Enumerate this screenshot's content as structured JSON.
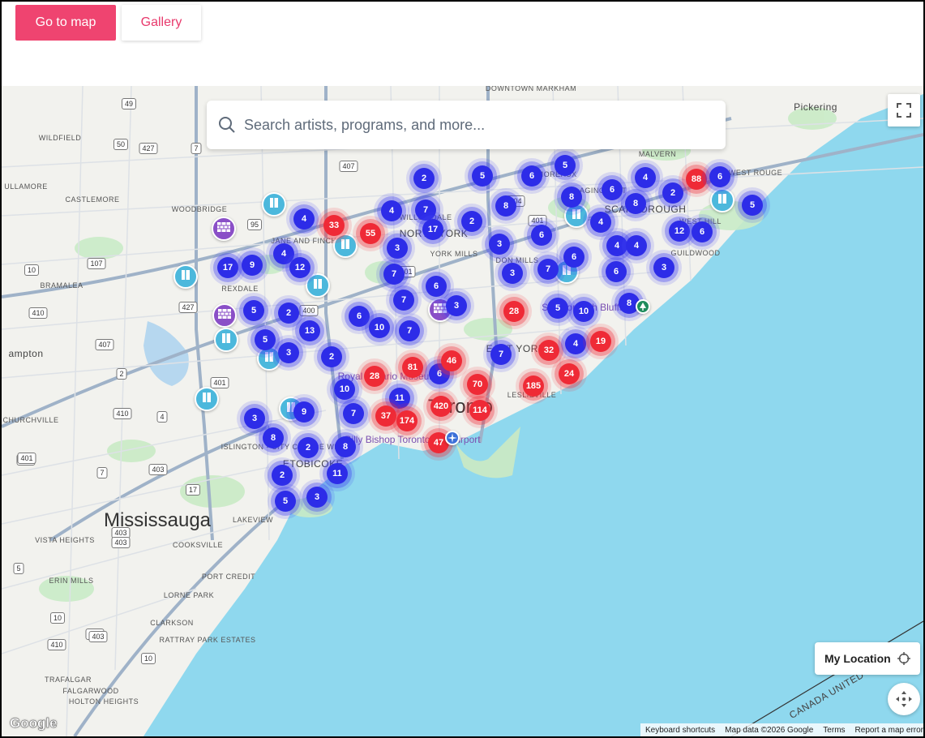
{
  "header": {
    "map_button": "Go to map",
    "gallery_button": "Gallery"
  },
  "search": {
    "placeholder": "Search artists, programs, and more..."
  },
  "controls": {
    "my_location": "My Location"
  },
  "attribution": {
    "keyboard": "Keyboard shortcuts",
    "mapdata": "Map data ©2026 Google",
    "terms": "Terms",
    "report": "Report a map error",
    "logo": "Google"
  },
  "colors": {
    "cluster_blue": "#2d2ce8",
    "cluster_red": "#ef2a36",
    "pin_cyan": "#4cb8dc",
    "pin_purple": "#8a4fc7",
    "water": "#8fd8ee",
    "accent": "#ef4470"
  },
  "labels": [
    {
      "text": "Mississauga",
      "cls": "big"
    },
    {
      "text": "Toronto",
      "cls": "big"
    },
    {
      "text": "Pickering",
      "cls": "mid"
    },
    {
      "text": "ampton",
      "cls": "mid"
    },
    {
      "text": "WILDFIELD",
      "cls": ""
    },
    {
      "text": "ULLAMORE",
      "cls": ""
    },
    {
      "text": "CASTLEMORE",
      "cls": ""
    },
    {
      "text": "WOODBRIDGE",
      "cls": ""
    },
    {
      "text": "BRAMALEA",
      "cls": ""
    },
    {
      "text": "REXDALE",
      "cls": ""
    },
    {
      "text": "JANE AND FINCH",
      "cls": ""
    },
    {
      "text": "NORTH YORK",
      "cls": "mid"
    },
    {
      "text": "YORK MILLS",
      "cls": ""
    },
    {
      "text": "DON MILLS",
      "cls": ""
    },
    {
      "text": "SCARBOROUGH",
      "cls": "mid"
    },
    {
      "text": "WEST HILL",
      "cls": ""
    },
    {
      "text": "GUILDWOOD",
      "cls": ""
    },
    {
      "text": "MALVERN",
      "cls": ""
    },
    {
      "text": "WEST ROUGE",
      "cls": ""
    },
    {
      "text": "AGINCOURT",
      "cls": ""
    },
    {
      "text": "L'AMOREAUX",
      "cls": ""
    },
    {
      "text": "WILLOWDALE",
      "cls": ""
    },
    {
      "text": "EAST YORK",
      "cls": "mid"
    },
    {
      "text": "LESLIEVILLE",
      "cls": ""
    },
    {
      "text": "ETOBICOKE",
      "cls": "mid"
    },
    {
      "text": "ISLINGTON - CITY CENTRE WEST",
      "cls": ""
    },
    {
      "text": "CHURCHVILLE",
      "cls": ""
    },
    {
      "text": "VISTA HEIGHTS",
      "cls": ""
    },
    {
      "text": "COOKSVILLE",
      "cls": ""
    },
    {
      "text": "ERIN MILLS",
      "cls": ""
    },
    {
      "text": "PORT CREDIT",
      "cls": ""
    },
    {
      "text": "LORNE PARK",
      "cls": ""
    },
    {
      "text": "CLARKSON",
      "cls": ""
    },
    {
      "text": "RATTRAY PARK ESTATES",
      "cls": ""
    },
    {
      "text": "TRAFALGAR",
      "cls": ""
    },
    {
      "text": "FALGARWOOD",
      "cls": ""
    },
    {
      "text": "HOLTON HEIGHTS",
      "cls": ""
    },
    {
      "text": "LAKEVIEW",
      "cls": ""
    },
    {
      "text": "Royal Ontario Museum",
      "cls": "poi"
    },
    {
      "text": "Billy Bishop Toronto City Airport",
      "cls": "poi"
    },
    {
      "text": "Scarborough Bluffs",
      "cls": "poi"
    },
    {
      "text": "DOWNTOWN MARKHAM",
      "cls": ""
    },
    {
      "text": "CANADA UNITED STATES",
      "cls": "mid"
    }
  ],
  "clusters": [
    {
      "n": "2",
      "c": "blue"
    },
    {
      "n": "5",
      "c": "blue"
    },
    {
      "n": "6",
      "c": "blue"
    },
    {
      "n": "5",
      "c": "blue"
    },
    {
      "n": "8",
      "c": "blue"
    },
    {
      "n": "6",
      "c": "blue"
    },
    {
      "n": "4",
      "c": "blue"
    },
    {
      "n": "2",
      "c": "blue"
    },
    {
      "n": "88",
      "c": "red"
    },
    {
      "n": "6",
      "c": "blue"
    },
    {
      "n": "5",
      "c": "blue"
    },
    {
      "n": "4",
      "c": "blue"
    },
    {
      "n": "33",
      "c": "red"
    },
    {
      "n": "55",
      "c": "red"
    },
    {
      "n": "4",
      "c": "blue"
    },
    {
      "n": "7",
      "c": "blue"
    },
    {
      "n": "17",
      "c": "blue"
    },
    {
      "n": "2",
      "c": "blue"
    },
    {
      "n": "8",
      "c": "blue"
    },
    {
      "n": "8",
      "c": "blue"
    },
    {
      "n": "4",
      "c": "blue"
    },
    {
      "n": "17",
      "c": "blue"
    },
    {
      "n": "9",
      "c": "blue"
    },
    {
      "n": "4",
      "c": "blue"
    },
    {
      "n": "12",
      "c": "blue"
    },
    {
      "n": "3",
      "c": "blue"
    },
    {
      "n": "3",
      "c": "blue"
    },
    {
      "n": "6",
      "c": "blue"
    },
    {
      "n": "4",
      "c": "blue"
    },
    {
      "n": "4",
      "c": "blue"
    },
    {
      "n": "12",
      "c": "blue"
    },
    {
      "n": "6",
      "c": "blue"
    },
    {
      "n": "7",
      "c": "blue"
    },
    {
      "n": "6",
      "c": "blue"
    },
    {
      "n": "7",
      "c": "blue"
    },
    {
      "n": "6",
      "c": "blue"
    },
    {
      "n": "3",
      "c": "blue"
    },
    {
      "n": "3",
      "c": "blue"
    },
    {
      "n": "6",
      "c": "blue"
    },
    {
      "n": "7",
      "c": "blue"
    },
    {
      "n": "3",
      "c": "blue"
    },
    {
      "n": "5",
      "c": "blue"
    },
    {
      "n": "2",
      "c": "blue"
    },
    {
      "n": "6",
      "c": "blue"
    },
    {
      "n": "10",
      "c": "blue"
    },
    {
      "n": "7",
      "c": "blue"
    },
    {
      "n": "28",
      "c": "red"
    },
    {
      "n": "5",
      "c": "blue"
    },
    {
      "n": "10",
      "c": "blue"
    },
    {
      "n": "8",
      "c": "blue"
    },
    {
      "n": "5",
      "c": "blue"
    },
    {
      "n": "13",
      "c": "blue"
    },
    {
      "n": "3",
      "c": "blue"
    },
    {
      "n": "2",
      "c": "blue"
    },
    {
      "n": "28",
      "c": "red"
    },
    {
      "n": "81",
      "c": "red"
    },
    {
      "n": "6",
      "c": "blue"
    },
    {
      "n": "46",
      "c": "red"
    },
    {
      "n": "7",
      "c": "blue"
    },
    {
      "n": "32",
      "c": "red"
    },
    {
      "n": "4",
      "c": "blue"
    },
    {
      "n": "19",
      "c": "red"
    },
    {
      "n": "24",
      "c": "red"
    },
    {
      "n": "70",
      "c": "red"
    },
    {
      "n": "185",
      "c": "red"
    },
    {
      "n": "10",
      "c": "blue"
    },
    {
      "n": "11",
      "c": "blue"
    },
    {
      "n": "420",
      "c": "red"
    },
    {
      "n": "114",
      "c": "red"
    },
    {
      "n": "37",
      "c": "red"
    },
    {
      "n": "174",
      "c": "red"
    },
    {
      "n": "7",
      "c": "blue"
    },
    {
      "n": "47",
      "c": "red"
    },
    {
      "n": "3",
      "c": "blue"
    },
    {
      "n": "9",
      "c": "blue"
    },
    {
      "n": "8",
      "c": "blue"
    },
    {
      "n": "2",
      "c": "blue"
    },
    {
      "n": "8",
      "c": "blue"
    },
    {
      "n": "2",
      "c": "blue"
    },
    {
      "n": "11",
      "c": "blue"
    },
    {
      "n": "5",
      "c": "blue"
    },
    {
      "n": "3",
      "c": "blue"
    }
  ],
  "pins": [
    {
      "kind": "cyan",
      "icon": "book-icon"
    },
    {
      "kind": "purple",
      "icon": "brick-wall-icon"
    },
    {
      "kind": "cyan",
      "icon": "book-icon"
    },
    {
      "kind": "cyan",
      "icon": "book-icon"
    },
    {
      "kind": "cyan",
      "icon": "book-icon"
    },
    {
      "kind": "purple",
      "icon": "brick-wall-icon"
    },
    {
      "kind": "cyan",
      "icon": "book-icon"
    },
    {
      "kind": "cyan",
      "icon": "book-icon"
    },
    {
      "kind": "cyan",
      "icon": "book-icon"
    },
    {
      "kind": "cyan",
      "icon": "book-icon"
    },
    {
      "kind": "purple",
      "icon": "brick-wall-icon"
    },
    {
      "kind": "cyan",
      "icon": "book-icon"
    },
    {
      "kind": "cyan",
      "icon": "book-icon"
    },
    {
      "kind": "cyan",
      "icon": "book-icon"
    }
  ],
  "highway_shields": [
    "49",
    "427",
    "50",
    "7",
    "407",
    "95",
    "107",
    "410",
    "427",
    "401",
    "407",
    "403",
    "403",
    "10",
    "17",
    "5",
    "400",
    "401",
    "404",
    "401",
    "2",
    "407",
    "7",
    "10",
    "410",
    "4",
    "401",
    "403",
    "10",
    "410",
    "403",
    "403"
  ]
}
